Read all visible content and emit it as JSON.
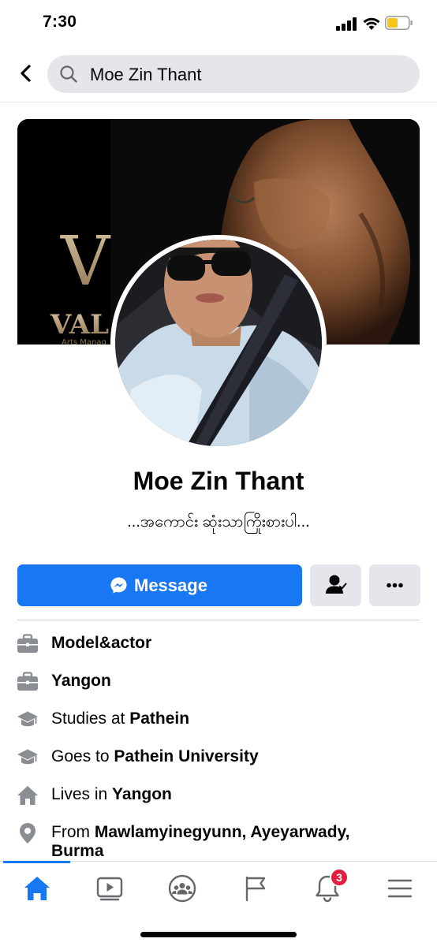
{
  "status_bar": {
    "time": "7:30"
  },
  "search": {
    "query": "Moe Zin Thant"
  },
  "cover": {
    "logo_letter": "V",
    "logo_text": "VAL",
    "logo_subtext": "Arts Manag"
  },
  "profile": {
    "name": "Moe Zin Thant",
    "bio": "...အကောင်း ဆုံးသာကြိုးစားပါ..."
  },
  "actions": {
    "message_label": "Message"
  },
  "intro": [
    {
      "icon": "briefcase-icon",
      "prefix": "",
      "bold": "Model&actor"
    },
    {
      "icon": "briefcase-icon",
      "prefix": "",
      "bold": "Yangon"
    },
    {
      "icon": "graduation-cap-icon",
      "prefix": "Studies at ",
      "bold": "Pathein"
    },
    {
      "icon": "graduation-cap-icon",
      "prefix": "Goes to ",
      "bold": "Pathein University"
    },
    {
      "icon": "house-icon",
      "prefix": "Lives in ",
      "bold": "Yangon"
    },
    {
      "icon": "location-pin-icon",
      "prefix": "From ",
      "bold": "Mawlamyinegyunn, Ayeyarwady, Burma"
    }
  ],
  "tabbar": {
    "tabs": [
      "home",
      "watch",
      "groups",
      "pages",
      "notifications",
      "menu"
    ],
    "notification_count": "3"
  },
  "colors": {
    "accent": "#1877f2",
    "badge": "#e41e3f",
    "icon_gray": "#8a8d91",
    "button_gray": "#e4e6eb"
  }
}
